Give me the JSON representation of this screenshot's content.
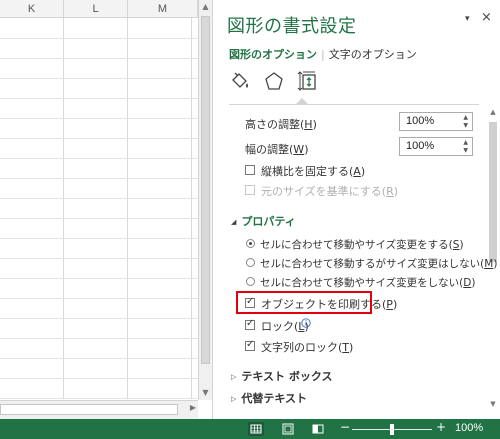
{
  "sheet": {
    "columns": [
      "K",
      "L",
      "M"
    ]
  },
  "pane": {
    "title": "図形の書式設定",
    "tabs": [
      "図形のオプション",
      "文字のオプション"
    ],
    "tab_separator": "|",
    "dropdown_glyph": "▾",
    "close_glyph": "×",
    "categories": [
      "fill-line-icon",
      "effects-icon",
      "size-properties-icon"
    ],
    "height_scale": {
      "label": "高さの調整(",
      "key": "H",
      "label_end": ")",
      "value": "100%"
    },
    "width_scale": {
      "label": "幅の調整(",
      "key": "W",
      "label_end": ")",
      "value": "100%"
    },
    "lock_aspect": {
      "label": "縦横比を固定する(",
      "key": "A",
      "label_end": ")",
      "checked": false
    },
    "relative_original": {
      "label": "元のサイズを基準にする(",
      "key": "R",
      "label_end": ")",
      "checked": false,
      "disabled": true
    },
    "properties_section": "プロパティ",
    "radio_options": [
      {
        "label": "セルに合わせて移動やサイズ変更をする(",
        "key": "S",
        "label_end": ")",
        "selected": true
      },
      {
        "label": "セルに合わせて移動するがサイズ変更はしない(",
        "key": "M",
        "label_end": ")",
        "selected": false
      },
      {
        "label": "セルに合わせて移動やサイズ変更をしない(",
        "key": "D",
        "label_end": ")",
        "selected": false
      }
    ],
    "print_object": {
      "label": "オブジェクトを印刷する(",
      "key": "P",
      "label_end": ")",
      "checked": true
    },
    "locked": {
      "label": "ロック(",
      "key": "L",
      "label_end": ")",
      "checked": true
    },
    "lock_text": {
      "label": "文字列のロック(",
      "key": "T",
      "label_end": ")",
      "checked": true
    },
    "textbox_section": "テキスト ボックス",
    "alttext_section": "代替テキスト"
  },
  "status_bar": {
    "zoom_minus": "−",
    "zoom_plus": "+",
    "zoom_level": "100%",
    "zoom_fraction": 0.5
  },
  "colors": {
    "accent": "#217346",
    "highlight_box": "#e0000f"
  }
}
